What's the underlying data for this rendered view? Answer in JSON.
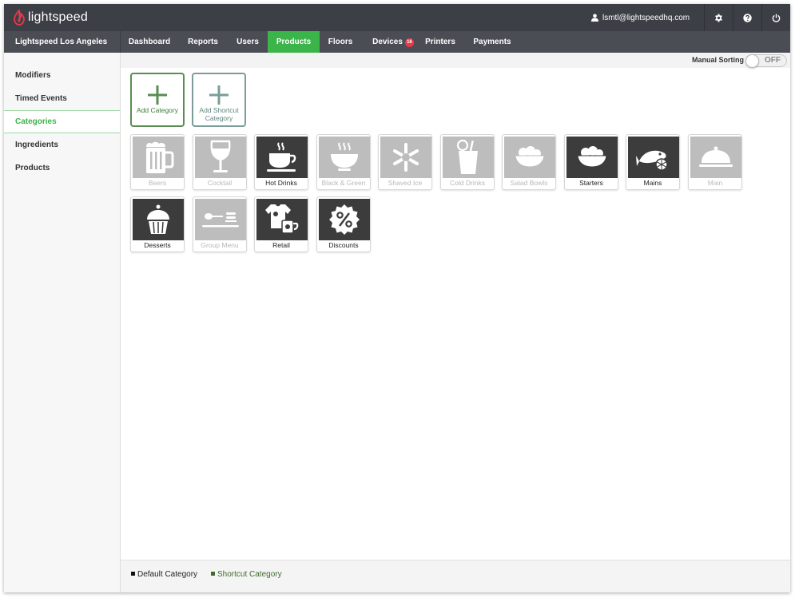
{
  "app": {
    "brand": "lightspeed"
  },
  "header": {
    "user_email": "lsmtl@lightspeedhq.com"
  },
  "nav": {
    "location": "Lightspeed Los Angeles",
    "tabs": [
      {
        "label": "Dashboard"
      },
      {
        "label": "Reports"
      },
      {
        "label": "Users"
      },
      {
        "label": "Products",
        "active": true
      },
      {
        "label": "Floors"
      },
      {
        "label": "Devices",
        "badge": "16"
      },
      {
        "label": "Printers"
      },
      {
        "label": "Payments"
      }
    ]
  },
  "sidebar": {
    "items": [
      {
        "label": "Modifiers"
      },
      {
        "label": "Timed Events"
      },
      {
        "label": "Categories",
        "active": true
      },
      {
        "label": "Ingredients"
      },
      {
        "label": "Products"
      }
    ]
  },
  "sorting": {
    "label": "Manual Sorting",
    "state": "OFF"
  },
  "actions": {
    "add_category": "Add Category",
    "add_shortcut": "Add Shortcut Category"
  },
  "categories": [
    {
      "label": "Beers",
      "icon": "beer-mug-icon",
      "enabled": false
    },
    {
      "label": "Cocktail",
      "icon": "wine-glass-icon",
      "enabled": false
    },
    {
      "label": "Hot Drinks",
      "icon": "coffee-cup-icon",
      "enabled": true
    },
    {
      "label": "Black & Green",
      "icon": "soup-bowl-icon",
      "enabled": false
    },
    {
      "label": "Shaved Ice",
      "icon": "snowflake-icon",
      "enabled": false
    },
    {
      "label": "Cold Drinks",
      "icon": "soda-glass-icon",
      "enabled": false
    },
    {
      "label": "Salad Bowls",
      "icon": "salad-bowl-icon",
      "enabled": false
    },
    {
      "label": "Starters",
      "icon": "starter-bowl-icon",
      "enabled": true
    },
    {
      "label": "Mains",
      "icon": "fish-icon",
      "enabled": true
    },
    {
      "label": "Main",
      "icon": "cloche-icon",
      "enabled": false
    },
    {
      "label": "Desserts",
      "icon": "cupcake-icon",
      "enabled": true
    },
    {
      "label": "Group Menu",
      "icon": "group-menu-icon",
      "enabled": false
    },
    {
      "label": "Retail",
      "icon": "tshirt-mug-icon",
      "enabled": true
    },
    {
      "label": "Discounts",
      "icon": "percent-badge-icon",
      "enabled": true
    }
  ],
  "legend": {
    "default": "Default Category",
    "shortcut": "Shortcut Category"
  },
  "colors": {
    "accent": "#3bb449",
    "topbar": "#3d3f47",
    "navbar": "#4b4d55",
    "badge": "#e8394a",
    "tile_default": "#3c3c3c",
    "tile_disabled": "#bdbdbd"
  }
}
